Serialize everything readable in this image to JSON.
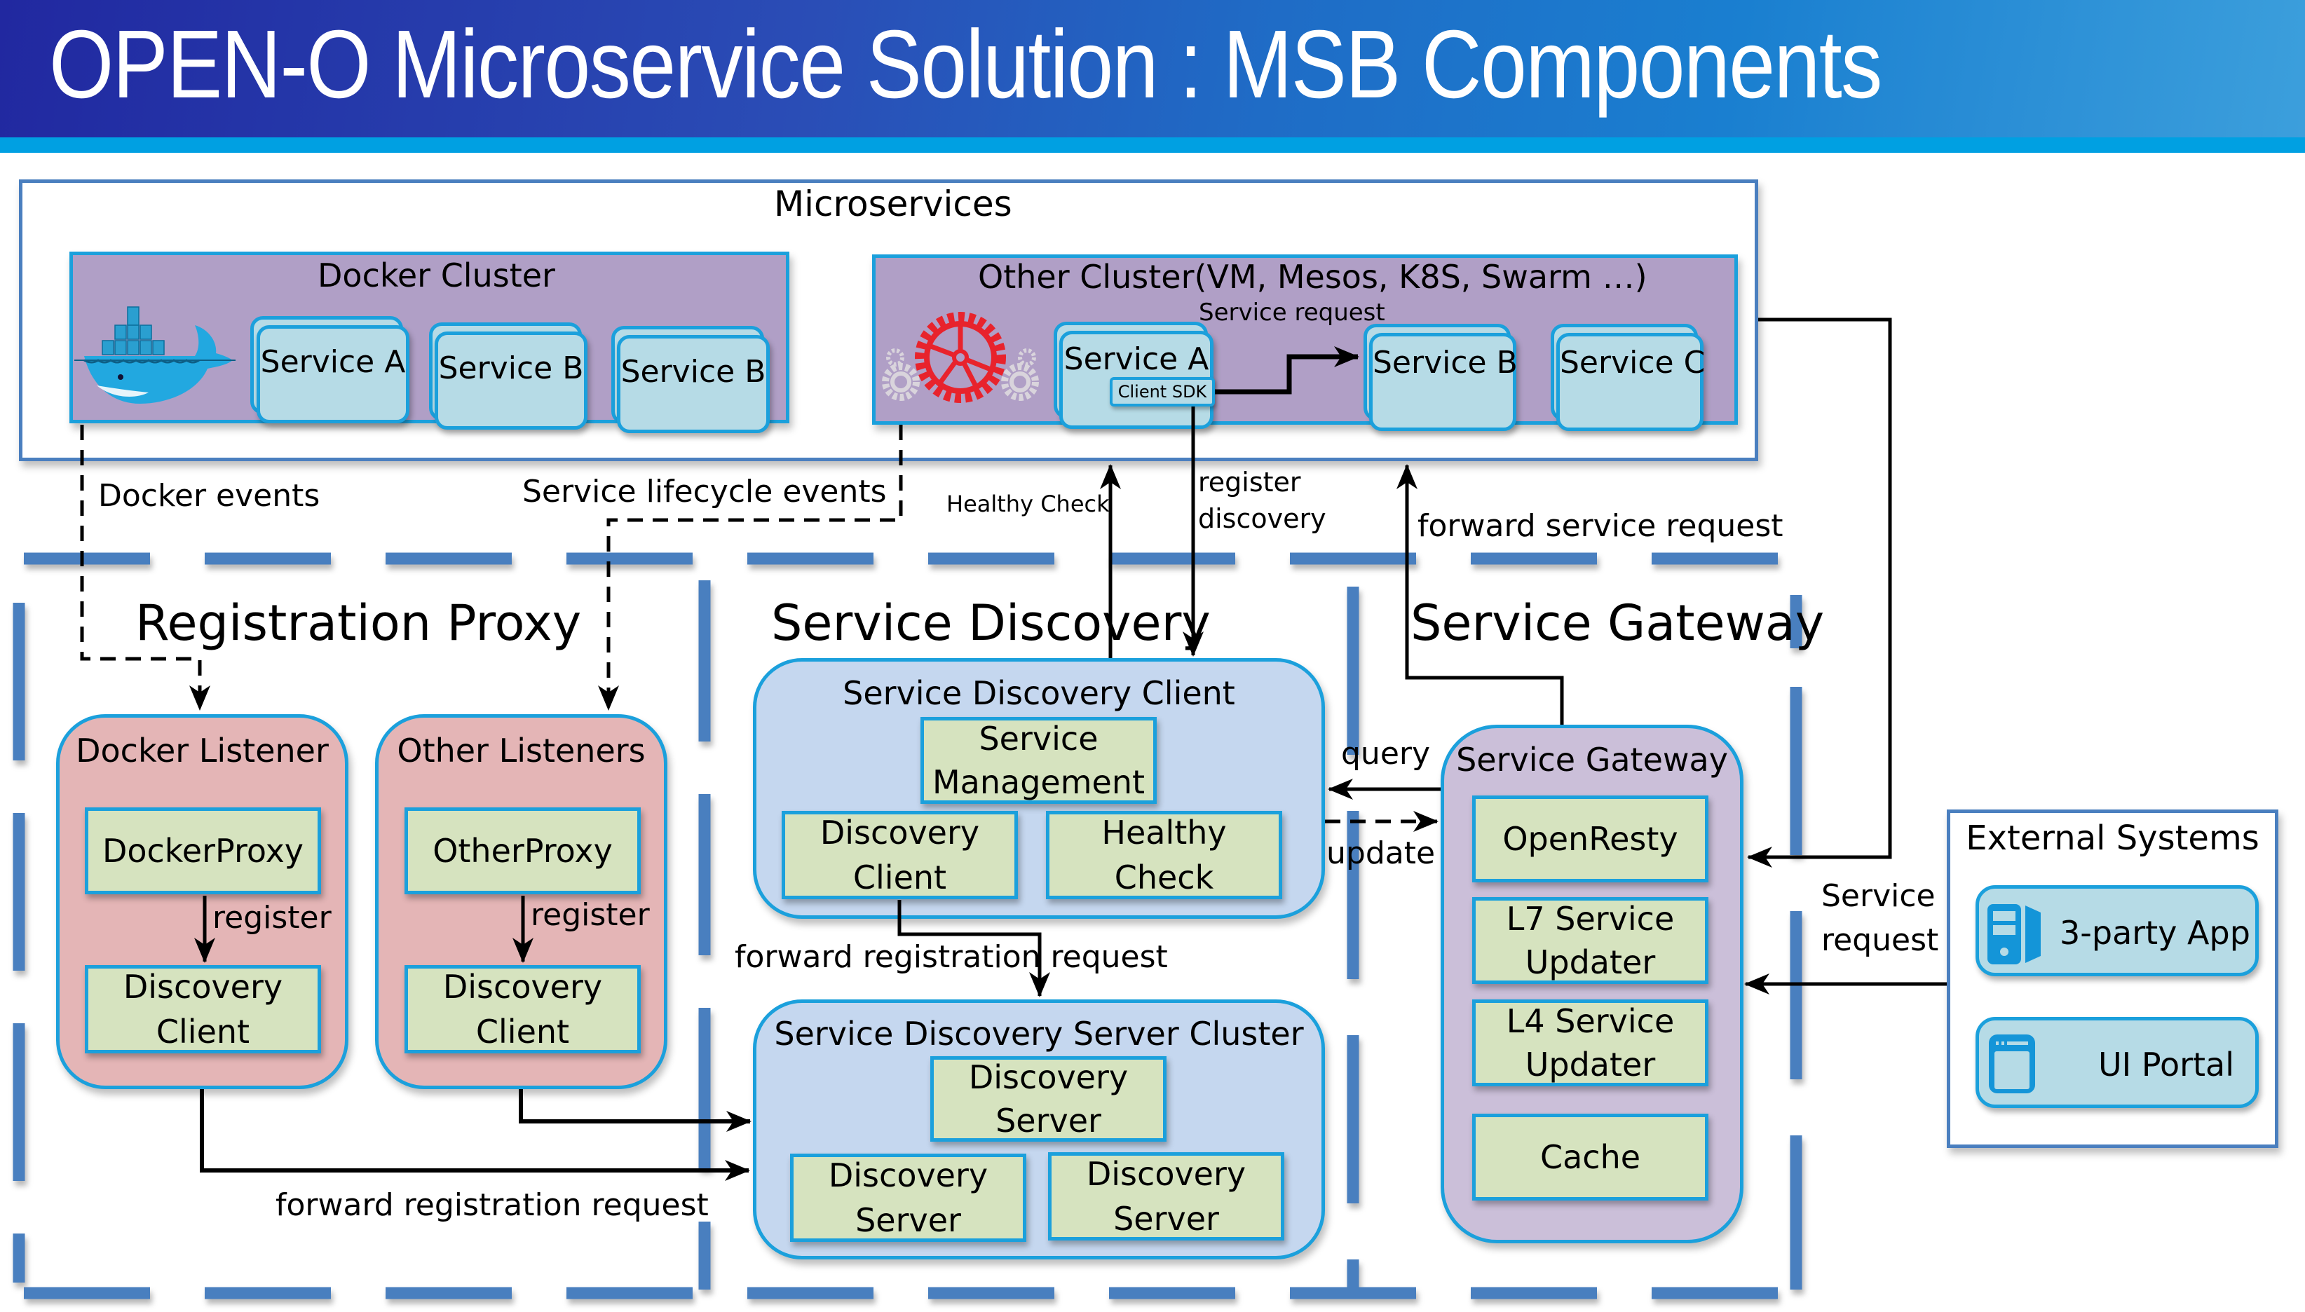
{
  "header": {
    "title": "OPEN-O Microservice Solution : MSB Components"
  },
  "microservices": {
    "title": "Microservices",
    "docker_cluster": {
      "title": "Docker Cluster",
      "icon": "docker-whale-icon",
      "services": [
        "Service A",
        "Service B",
        "Service B"
      ]
    },
    "other_cluster": {
      "title": "Other Cluster(VM, Mesos, K8S, Swarm …)",
      "icon": "gears-icon",
      "services": [
        "Service A",
        "Service B",
        "Service C"
      ],
      "client_sdk_label": "Client SDK",
      "service_request_label": "Service request"
    }
  },
  "connectors": {
    "docker_events": "Docker events",
    "service_lifecycle_events": "Service lifecycle events",
    "healthy_check": "Healthy Check",
    "register": "register",
    "discovery": "discovery",
    "forward_service_request": "forward service request",
    "query": "query",
    "update": "update",
    "forward_registration_request_top": "forward registration request",
    "forward_registration_request_bottom": "forward registration request",
    "service_request_line1": "Service",
    "service_request_line2": "request"
  },
  "sections": {
    "registration_proxy": "Registration Proxy",
    "service_discovery": "Service Discovery",
    "service_gateway": "Service Gateway"
  },
  "registration_proxy": {
    "docker_listener": {
      "title": "Docker Listener",
      "proxy": "DockerProxy",
      "register_label": "register",
      "client_line1": "Discovery",
      "client_line2": "Client"
    },
    "other_listeners": {
      "title": "Other Listeners",
      "proxy": "OtherProxy",
      "register_label": "register",
      "client_line1": "Discovery",
      "client_line2": "Client"
    }
  },
  "service_discovery": {
    "client": {
      "title": "Service Discovery Client",
      "management_line1": "Service",
      "management_line2": "Management",
      "discovery_client_line1": "Discovery",
      "discovery_client_line2": "Client",
      "healthy_check_line1": "Healthy",
      "healthy_check_line2": "Check"
    },
    "server_cluster": {
      "title": "Service Discovery Server Cluster",
      "servers": [
        {
          "line1": "Discovery",
          "line2": "Server"
        },
        {
          "line1": "Discovery",
          "line2": "Server"
        },
        {
          "line1": "Discovery",
          "line2": "Server"
        }
      ]
    }
  },
  "service_gateway": {
    "title": "Service Gateway",
    "components": [
      {
        "line1": "OpenResty",
        "line2": ""
      },
      {
        "line1": "L7 Service",
        "line2": "Updater"
      },
      {
        "line1": "L4 Service",
        "line2": "Updater"
      },
      {
        "line1": "Cache",
        "line2": ""
      }
    ]
  },
  "external_systems": {
    "title": "External Systems",
    "items": [
      {
        "label": "3-party App",
        "icon": "server-tower-icon"
      },
      {
        "label": "UI Portal",
        "icon": "browser-window-icon"
      }
    ]
  },
  "colors": {
    "header_dark": "#2128a0",
    "header_band": "#00a0e2",
    "section_dash": "#4a7fbf",
    "cluster_purple": "#b09fc6",
    "service_blue": "#b6dbe6",
    "border_cyan": "#1ba0dc",
    "listener_pink": "#e4b5b6",
    "discovery_blue": "#c5d7ef",
    "gateway_lilac": "#cbbfd9",
    "component_green": "#d6e3bf"
  }
}
